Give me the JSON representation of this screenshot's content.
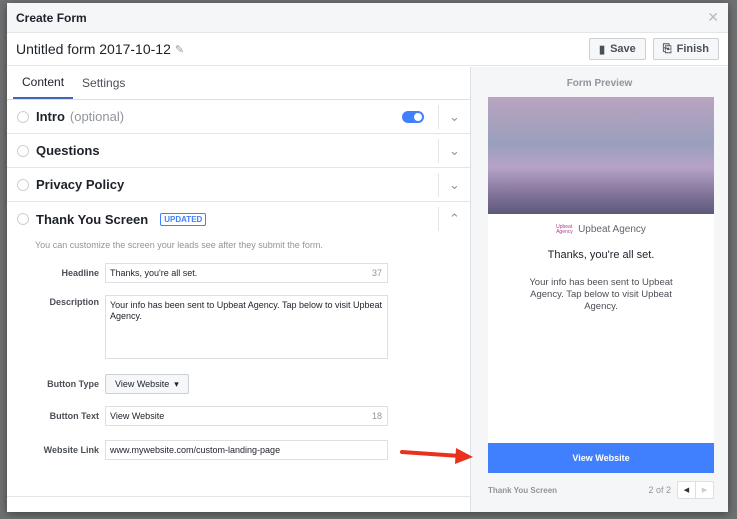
{
  "modal": {
    "title": "Create Form",
    "form_name": "Untitled form 2017-10-12",
    "save": "Save",
    "finish": "Finish"
  },
  "tabs": [
    "Content",
    "Settings"
  ],
  "sections": {
    "intro": "Intro",
    "intro_optional": "(optional)",
    "questions": "Questions",
    "privacy": "Privacy Policy",
    "thank_you": "Thank You Screen",
    "badge": "UPDATED"
  },
  "thank_you": {
    "help": "You can customize the screen your leads see after they submit the form.",
    "headline_label": "Headline",
    "headline": "Thanks, you're all set.",
    "headline_count": "37",
    "description_label": "Description",
    "description": "Your info has been sent to Upbeat Agency. Tap below to visit Upbeat Agency.",
    "button_type_label": "Button Type",
    "button_type": "View Website",
    "button_text_label": "Button Text",
    "button_text": "View Website",
    "button_text_count": "18",
    "link_label": "Website Link",
    "link": "www.mywebsite.com/custom-landing-page"
  },
  "preview": {
    "title": "Form Preview",
    "brand": "Upbeat Agency",
    "logo_text": "Upbeat Agency",
    "headline": "Thanks, you're all set.",
    "description": "Your info has been sent to Upbeat Agency. Tap below to visit Upbeat Agency.",
    "cta": "View Website",
    "screen": "Thank You Screen",
    "page": "2 of 2"
  },
  "colors": {
    "accent": "#4080ff",
    "arrow": "#e8321e"
  }
}
